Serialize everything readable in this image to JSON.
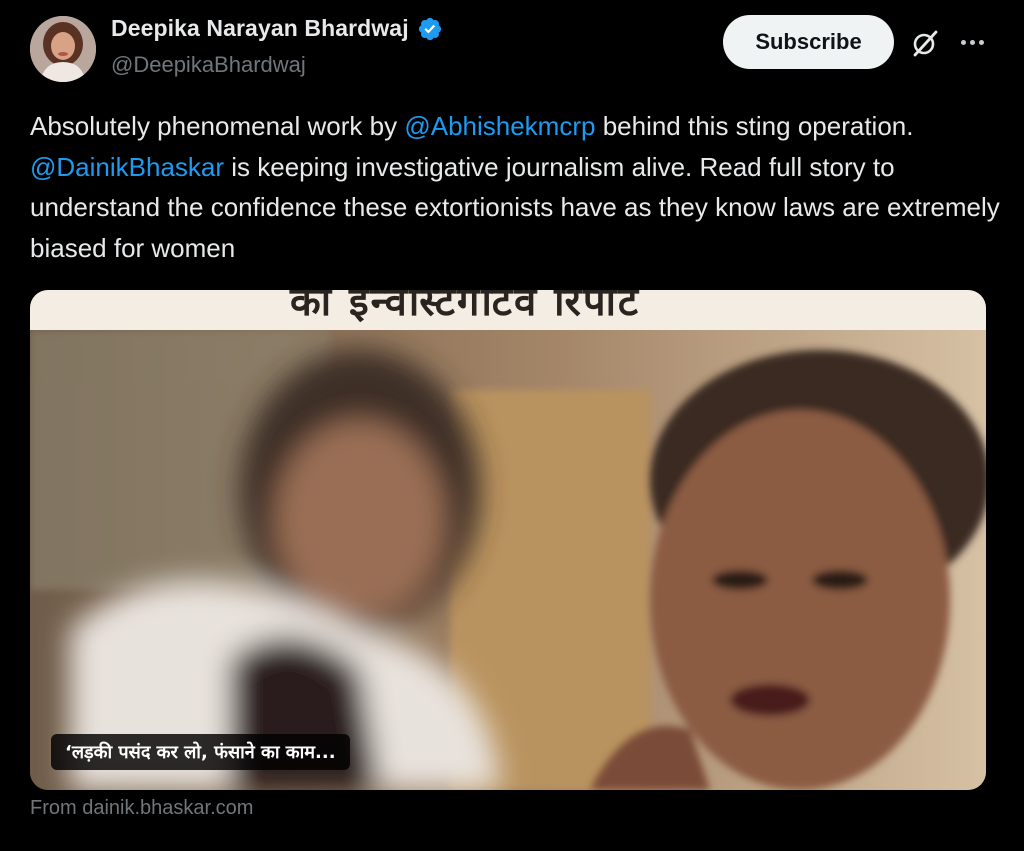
{
  "author": {
    "display_name": "Deepika Narayan Bhardwaj",
    "handle": "@DeepikaBhardwaj",
    "verified": true,
    "verified_icon": "verified-badge-icon"
  },
  "actions": {
    "subscribe_label": "Subscribe",
    "grok_icon": "grok-icon",
    "more_icon": "more-options-icon"
  },
  "tweet": {
    "text_1": "Absolutely phenomenal work by ",
    "mention_1": "@Abhishekmcrp",
    "text_2": " behind this sting operation. ",
    "mention_2": "@DainikBhaskar",
    "text_3": " is keeping investigative journalism alive. Read full story to understand the confidence these extortionists have as they know laws are extremely biased for women"
  },
  "card": {
    "header_text": "का इन्वेस्टिगेटिव रिपोर्ट",
    "caption": "‘लड़की पसंद कर लो, फंसाने का काम...",
    "source": "From dainik.bhaskar.com"
  },
  "colors": {
    "background": "#000000",
    "text": "#e7e9ea",
    "secondary": "#71767b",
    "link": "#1d9bf0",
    "subscribe_bg": "#eff3f4"
  }
}
